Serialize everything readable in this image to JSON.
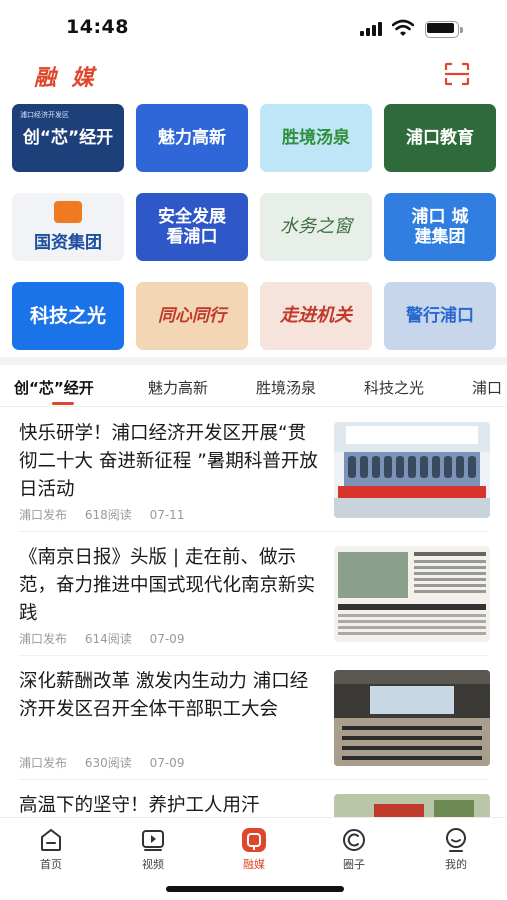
{
  "status_bar": {
    "time": "14:48"
  },
  "header": {
    "title": "融 媒"
  },
  "grid": {
    "tiles": [
      {
        "label": "创“芯”经开",
        "sub": "浦口经济开发区",
        "bg": "#1d3f7a",
        "color": "#ffffff"
      },
      {
        "label": "魅力高新",
        "sub": "",
        "bg": "#2f66d8",
        "color": "#ffffff"
      },
      {
        "label": "胜境汤泉",
        "sub": "",
        "bg": "#bfe6f6",
        "color": "#2f8f3c"
      },
      {
        "label": "浦口教育",
        "sub": "",
        "bg": "#2f6b3a",
        "color": "#ffffff"
      },
      {
        "label": "国资集团",
        "sub": "",
        "bg": "#f1f3f7",
        "color": "#1e4e9e"
      },
      {
        "label": "安全发展 看浦口",
        "sub": "",
        "bg": "#2e57c7",
        "color": "#ffffff"
      },
      {
        "label": "水务之窗",
        "sub": "",
        "bg": "#e7efe8",
        "color": "#3c6f3c"
      },
      {
        "label": "浦口 城建集团",
        "sub": "",
        "bg": "#2f7ee0",
        "color": "#ffffff"
      },
      {
        "label": "科技之光",
        "sub": "",
        "bg": "#1a73e8",
        "color": "#ffffff"
      },
      {
        "label": "同心同行",
        "sub": "",
        "bg": "#f3d6b4",
        "color": "#c0392b"
      },
      {
        "label": "走进机关",
        "sub": "",
        "bg": "#f5e3dc",
        "color": "#c0392b"
      },
      {
        "label": "警行浦口",
        "sub": "",
        "bg": "#c7d6ea",
        "color": "#2a6ad0"
      }
    ]
  },
  "tabs": [
    "创“芯”经开",
    "魅力高新",
    "胜境汤泉",
    "科技之光",
    "浦口"
  ],
  "articles": [
    {
      "title": "快乐研学！浦口经济开发区开展“贯彻二十大 奋进新征程 ”暑期科普开放日活动",
      "source": "浦口发布",
      "reads": "618阅读",
      "date": "07-11"
    },
    {
      "title": "《南京日报》头版 | 走在前、做示范，奋力推进中国式现代化南京新实践",
      "source": "浦口发布",
      "reads": "614阅读",
      "date": "07-09"
    },
    {
      "title": "深化薪酬改革 激发内生动力 浦口经济开发区召开全体干部职工大会",
      "source": "浦口发布",
      "reads": "630阅读",
      "date": "07-09"
    },
    {
      "title": "高温下的坚守！养护工人用汗",
      "source": "",
      "reads": "",
      "date": ""
    }
  ],
  "bottom_nav": [
    {
      "label": "首页",
      "icon": "home-icon"
    },
    {
      "label": "视频",
      "icon": "video-icon"
    },
    {
      "label": "融媒",
      "icon": "media-icon"
    },
    {
      "label": "圈子",
      "icon": "circle-icon"
    },
    {
      "label": "我的",
      "icon": "profile-icon"
    }
  ],
  "colors": {
    "accent": "#e0462c"
  }
}
